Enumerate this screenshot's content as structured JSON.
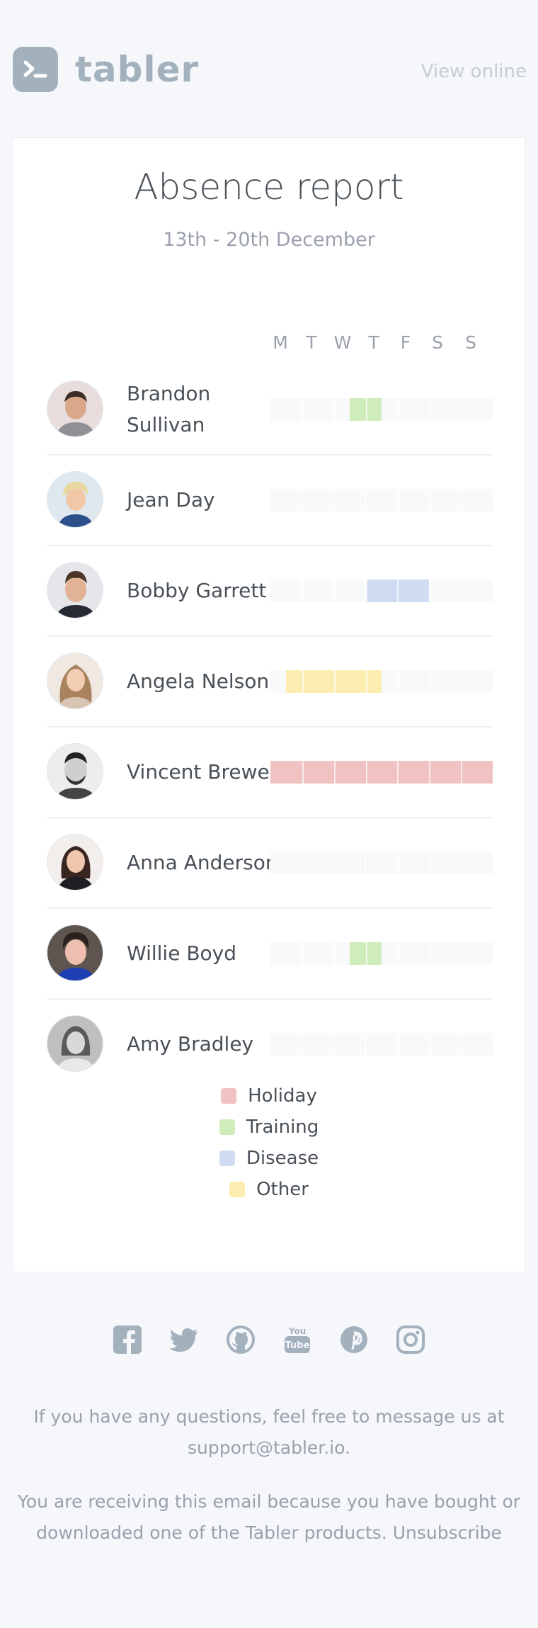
{
  "header": {
    "brand": "tabler",
    "view_online": "View online"
  },
  "report": {
    "title": "Absence report",
    "date_range": "13th - 20th December",
    "days": [
      "M",
      "T",
      "W",
      "T",
      "F",
      "S",
      "S"
    ],
    "employees": [
      {
        "name": "Brandon Sullivan",
        "absence": {
          "type": "Training",
          "start_day": 2.5,
          "end_day": 3.5
        }
      },
      {
        "name": "Jean Day",
        "absence": null
      },
      {
        "name": "Bobby Garrett",
        "absence": {
          "type": "Disease",
          "start_day": 3.0,
          "end_day": 5.0
        }
      },
      {
        "name": "Angela Nelson",
        "absence": {
          "type": "Other",
          "start_day": 0.5,
          "end_day": 3.5
        }
      },
      {
        "name": "Vincent Brewer",
        "absence": {
          "type": "Holiday",
          "start_day": 0.0,
          "end_day": 7.0
        }
      },
      {
        "name": "Anna Anderson",
        "absence": null
      },
      {
        "name": "Willie Boyd",
        "absence": {
          "type": "Training",
          "start_day": 2.5,
          "end_day": 3.5
        }
      },
      {
        "name": "Amy Bradley",
        "absence": null
      }
    ]
  },
  "legend": [
    {
      "label": "Holiday",
      "color": "#f0c2c2"
    },
    {
      "label": "Training",
      "color": "#cfecba"
    },
    {
      "label": "Disease",
      "color": "#cfdcf2"
    },
    {
      "label": "Other",
      "color": "#fcedb1"
    }
  ],
  "footer": {
    "social_icons": [
      "facebook-icon",
      "twitter-icon",
      "github-icon",
      "youtube-icon",
      "pinterest-icon",
      "instagram-icon"
    ],
    "questions_text": "If you have any questions, feel free to message us at",
    "support_email": "support@tabler.io",
    "receiving_text": "You are receiving this email because you have bought or downloaded one of the Tabler products.",
    "unsubscribe": "Unsubscribe"
  }
}
